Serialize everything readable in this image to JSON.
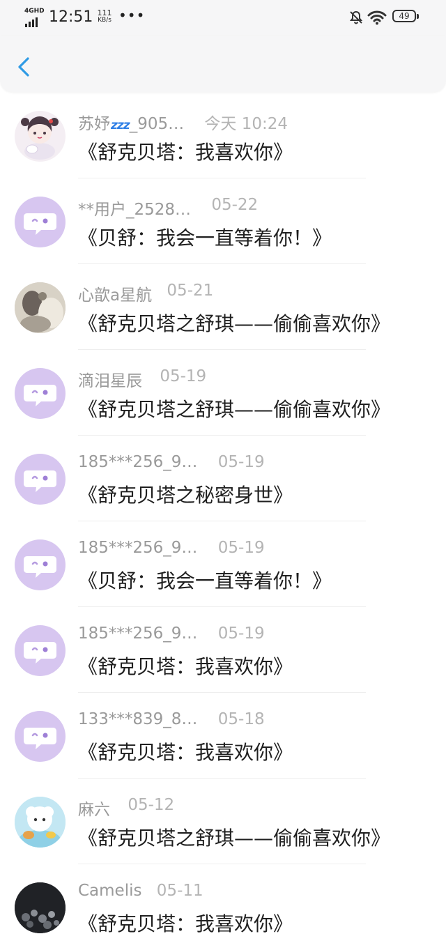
{
  "status_bar": {
    "network": "4GHD",
    "time": "12:51",
    "speed_value": "111",
    "speed_unit": "KB/s",
    "overflow": "•••",
    "battery": "49",
    "icons": [
      "signal-icon",
      "bell-off-icon",
      "wifi-icon",
      "battery-icon"
    ]
  },
  "nav": {
    "back_icon": "chevron-left-icon",
    "accent": "#2f9be5"
  },
  "colors": {
    "default_avatar": "#d7c6f0",
    "name": "#9a9a9a",
    "title": "#1f1f1f"
  },
  "messages": [
    {
      "name": "苏妤",
      "name_suffix": "_905…",
      "badge": "zzz",
      "time": "今天 10:24",
      "title": "《舒克贝塔：我喜欢你》",
      "avatar": "anime-girl-avatar"
    },
    {
      "name": "**用户_2528…",
      "time": "05-22",
      "title": "《贝舒：我会一直等着你！》",
      "avatar": "default-chat-avatar"
    },
    {
      "name": "心歆a星航",
      "time": "05-21",
      "title": "《舒克贝塔之舒琪——偷偷喜欢你》",
      "avatar": "photo-avatar"
    },
    {
      "name": "滴泪星辰",
      "time": "05-19",
      "title": "《舒克贝塔之舒琪——偷偷喜欢你》",
      "avatar": "default-chat-avatar"
    },
    {
      "name": "185***256_9…",
      "time": "05-19",
      "title": "《舒克贝塔之秘密身世》",
      "avatar": "default-chat-avatar"
    },
    {
      "name": "185***256_9…",
      "time": "05-19",
      "title": "《贝舒：我会一直等着你！》",
      "avatar": "default-chat-avatar"
    },
    {
      "name": "185***256_9…",
      "time": "05-19",
      "title": "《舒克贝塔：我喜欢你》",
      "avatar": "default-chat-avatar"
    },
    {
      "name": "133***839_8…",
      "time": "05-18",
      "title": "《舒克贝塔：我喜欢你》",
      "avatar": "default-chat-avatar"
    },
    {
      "name": "麻六",
      "time": "05-12",
      "title": "《舒克贝塔之舒琪——偷偷喜欢你》",
      "avatar": "cartoon-sheep-avatar"
    },
    {
      "name": "Camelis",
      "time": "05-11",
      "title": "《舒克贝塔：我喜欢你》",
      "avatar": "dark-flowers-avatar"
    }
  ]
}
